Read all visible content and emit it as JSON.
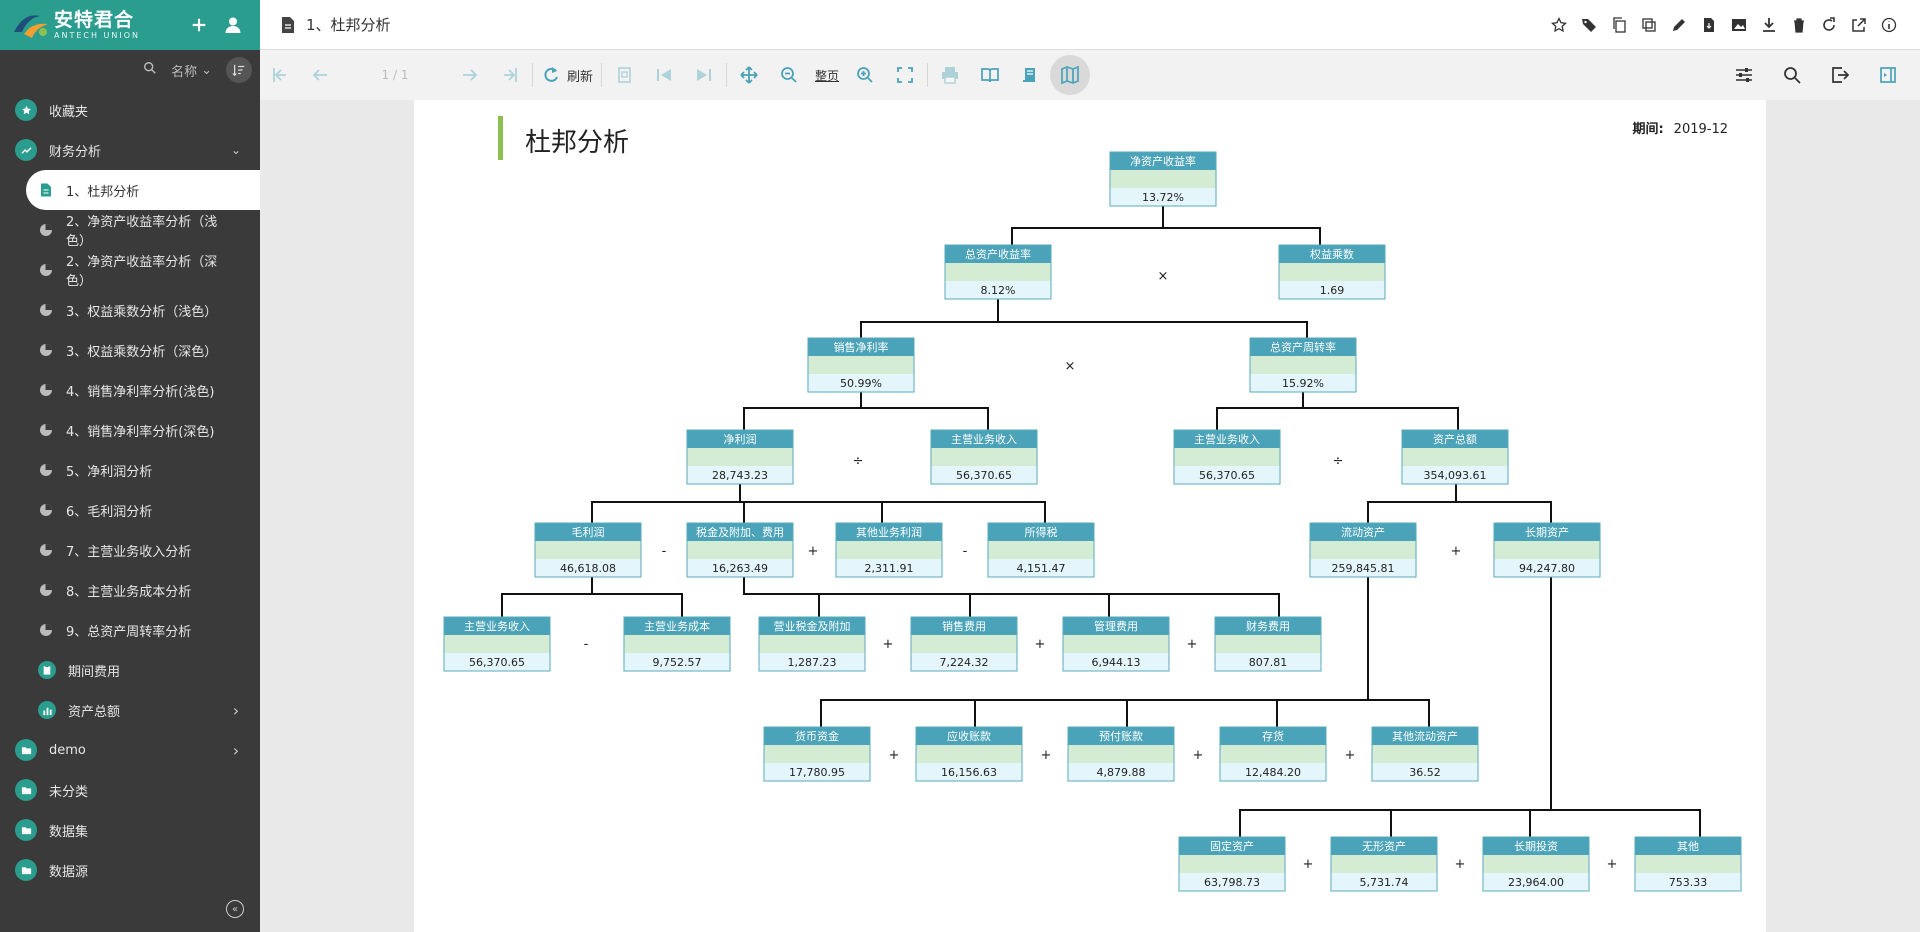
{
  "brand": {
    "name_cn": "安特君合",
    "name_en": "ANTECH UNION"
  },
  "sidebar": {
    "sort_label": "名称",
    "items": [
      {
        "label": "收藏夹",
        "level": 1,
        "icon": "star-icon"
      },
      {
        "label": "财务分析",
        "level": 1,
        "icon": "trend-icon",
        "expanded": true
      },
      {
        "label": "1、杜邦分析",
        "level": 2,
        "icon": "document-icon",
        "active": true
      },
      {
        "label": "2、净资产收益率分析（浅色）",
        "level": 2,
        "icon": "pie-icon"
      },
      {
        "label": "2、净资产收益率分析（深色）",
        "level": 2,
        "icon": "pie-icon"
      },
      {
        "label": "3、权益乘数分析（浅色）",
        "level": 2,
        "icon": "pie-icon"
      },
      {
        "label": "3、权益乘数分析（深色）",
        "level": 2,
        "icon": "pie-icon"
      },
      {
        "label": "4、销售净利率分析(浅色)",
        "level": 2,
        "icon": "pie-icon"
      },
      {
        "label": "4、销售净利率分析(深色)",
        "level": 2,
        "icon": "pie-icon"
      },
      {
        "label": "5、净利润分析",
        "level": 2,
        "icon": "pie-icon"
      },
      {
        "label": "6、毛利润分析",
        "level": 2,
        "icon": "pie-icon"
      },
      {
        "label": "7、主营业务收入分析",
        "level": 2,
        "icon": "pie-icon"
      },
      {
        "label": "8、主营业务成本分析",
        "level": 2,
        "icon": "pie-icon"
      },
      {
        "label": "9、总资产周转率分析",
        "level": 2,
        "icon": "pie-icon"
      },
      {
        "label": "期间费用",
        "level": 2,
        "icon": "clipboard-icon"
      },
      {
        "label": "资产总额",
        "level": 2,
        "icon": "bar-chart-icon",
        "collapsed": true
      },
      {
        "label": "demo",
        "level": 1,
        "icon": "folder-icon",
        "collapsed": true
      },
      {
        "label": "未分类",
        "level": 1,
        "icon": "folder-icon"
      },
      {
        "label": "数据集",
        "level": 1,
        "icon": "folder-icon"
      },
      {
        "label": "数据源",
        "level": 1,
        "icon": "folder-icon"
      }
    ]
  },
  "header": {
    "title": "1、杜邦分析"
  },
  "toolbar": {
    "page_indicator": "1 / 1",
    "refresh_label": "刷新",
    "fit_label": "整页"
  },
  "report": {
    "title": "杜邦分析",
    "period_label": "期间:",
    "period_value": "2019-12",
    "nodes": [
      {
        "name": "净资产收益率",
        "value": "13.72%"
      },
      {
        "name": "总资产收益率",
        "value": "8.12%"
      },
      {
        "name": "权益乘数",
        "value": "1.69"
      },
      {
        "name": "销售净利率",
        "value": "50.99%"
      },
      {
        "name": "总资产周转率",
        "value": "15.92%"
      },
      {
        "name": "净利润",
        "value": "28,743.23"
      },
      {
        "name": "主营业务收入",
        "value": "56,370.65"
      },
      {
        "name": "主营业务收入",
        "value": "56,370.65"
      },
      {
        "name": "资产总额",
        "value": "354,093.61"
      },
      {
        "name": "毛利润",
        "value": "46,618.08"
      },
      {
        "name": "税金及附加、费用",
        "value": "16,263.49"
      },
      {
        "name": "其他业务利润",
        "value": "2,311.91"
      },
      {
        "name": "所得税",
        "value": "4,151.47"
      },
      {
        "name": "流动资产",
        "value": "259,845.81"
      },
      {
        "name": "长期资产",
        "value": "94,247.80"
      },
      {
        "name": "主营业务收入",
        "value": "56,370.65"
      },
      {
        "name": "主营业务成本",
        "value": "9,752.57"
      },
      {
        "name": "营业税金及附加",
        "value": "1,287.23"
      },
      {
        "name": "销售费用",
        "value": "7,224.32"
      },
      {
        "name": "管理费用",
        "value": "6,944.13"
      },
      {
        "name": "财务费用",
        "value": "807.81"
      },
      {
        "name": "货币资金",
        "value": "17,780.95"
      },
      {
        "name": "应收账款",
        "value": "16,156.63"
      },
      {
        "name": "预付账款",
        "value": "4,879.88"
      },
      {
        "name": "存货",
        "value": "12,484.20"
      },
      {
        "name": "其他流动资产",
        "value": "36.52"
      },
      {
        "name": "固定资产",
        "value": "63,798.73"
      },
      {
        "name": "无形资产",
        "value": "5,731.74"
      },
      {
        "name": "长期投资",
        "value": "23,964.00"
      },
      {
        "name": "其他",
        "value": "753.33"
      }
    ],
    "operators": [
      "×",
      "×",
      "÷",
      "÷",
      "-",
      "+",
      "-",
      "+",
      "-",
      "+",
      "+",
      "+",
      "+",
      "+",
      "+",
      "+",
      "+",
      "+",
      "+"
    ]
  }
}
